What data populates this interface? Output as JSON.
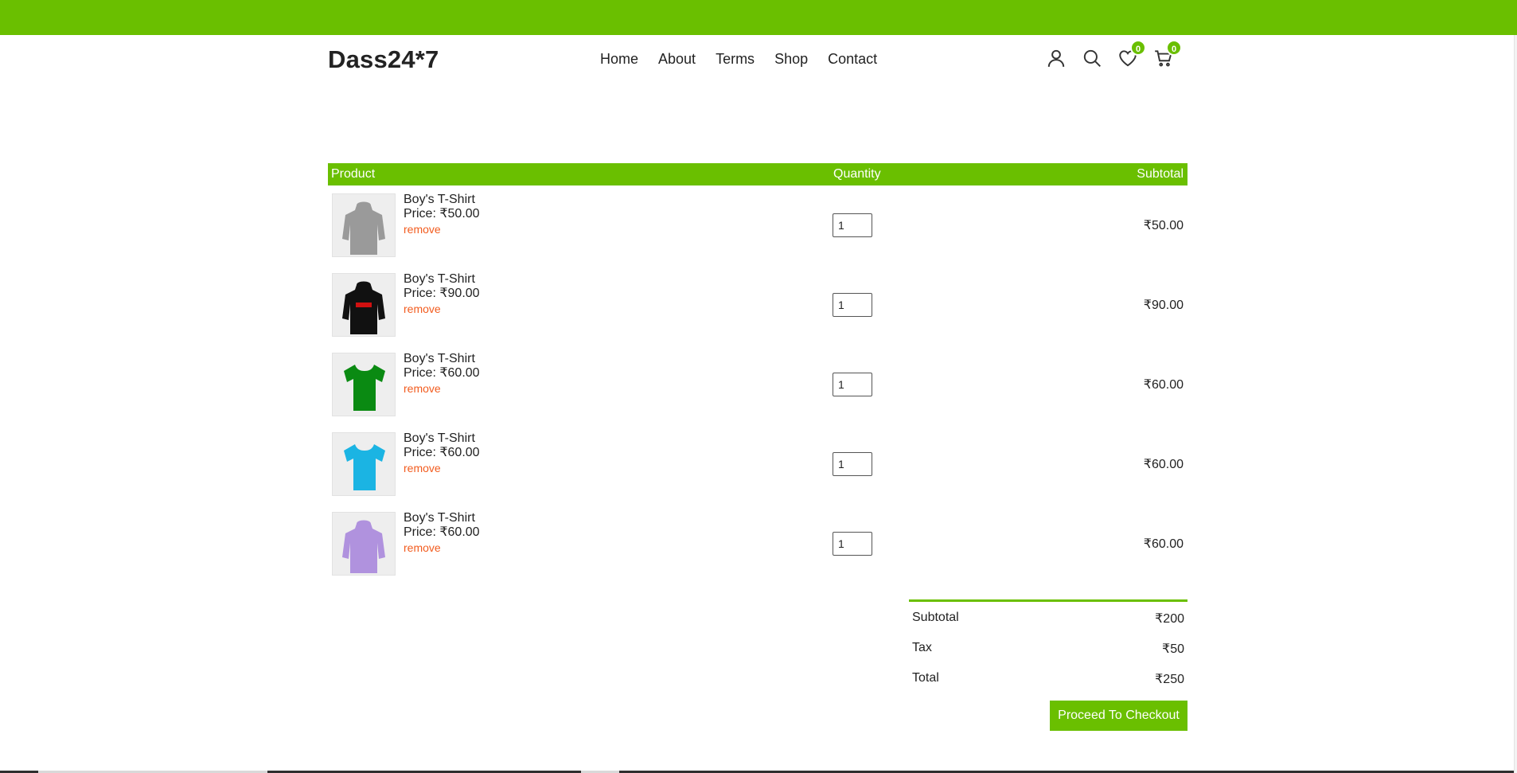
{
  "header": {
    "logo": "Dass24*7",
    "nav": [
      "Home",
      "About",
      "Terms",
      "Shop",
      "Contact"
    ],
    "wishlist_count": "0",
    "cart_count": "0"
  },
  "cart": {
    "headers": {
      "product": "Product",
      "quantity": "Quantity",
      "subtotal": "Subtotal"
    },
    "items": [
      {
        "name": "Boy's T-Shirt",
        "price": "Price: ₹50.00",
        "remove": "remove",
        "qty": "1",
        "subtotal": "₹50.00",
        "image": "grey-hoodie",
        "color": "#9a9a9a"
      },
      {
        "name": "Boy's T-Shirt",
        "price": "Price: ₹90.00",
        "remove": "remove",
        "qty": "1",
        "subtotal": "₹90.00",
        "image": "black-hoodie",
        "color": "#111111"
      },
      {
        "name": "Boy's T-Shirt",
        "price": "Price: ₹60.00",
        "remove": "remove",
        "qty": "1",
        "subtotal": "₹60.00",
        "image": "green-tshirt",
        "color": "#0a8a12"
      },
      {
        "name": "Boy's T-Shirt",
        "price": "Price: ₹60.00",
        "remove": "remove",
        "qty": "1",
        "subtotal": "₹60.00",
        "image": "blue-tshirt",
        "color": "#1bb4e3"
      },
      {
        "name": "Boy's T-Shirt",
        "price": "Price: ₹60.00",
        "remove": "remove",
        "qty": "1",
        "subtotal": "₹60.00",
        "image": "lavender-hoodie",
        "color": "#b092de"
      }
    ]
  },
  "totals": {
    "subtotal_label": "Subtotal",
    "subtotal": "₹200",
    "tax_label": "Tax",
    "tax": "₹50",
    "total_label": "Total",
    "total": "₹250"
  },
  "checkout_label": "Proceed To Checkout",
  "colors": {
    "accent": "#6abf00",
    "remove": "#f25c1f"
  }
}
